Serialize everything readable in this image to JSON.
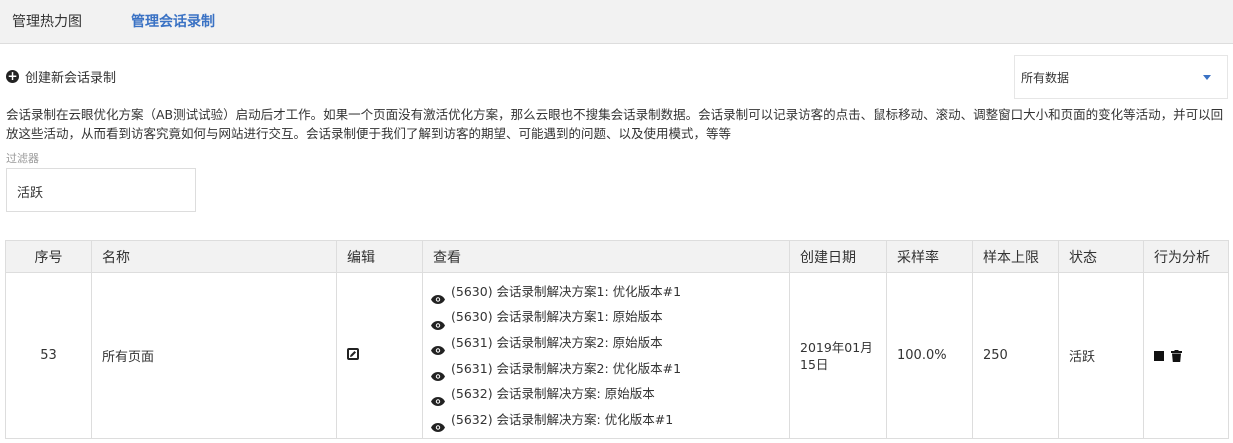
{
  "tabs": [
    {
      "label": "管理热力图",
      "active": false
    },
    {
      "label": "管理会话录制",
      "active": true
    }
  ],
  "create_button": {
    "label": "创建新会话录制",
    "icon": "plus-circle-icon"
  },
  "data_select": {
    "value": "所有数据"
  },
  "description": "会话录制在云眼优化方案（AB测试试验）启动后才工作。如果一个页面没有激活优化方案，那么云眼也不搜集会话录制数据。会话录制可以记录访客的点击、鼠标移动、滚动、调整窗口大小和页面的变化等活动，并可以回放这些活动，从而看到访客究竟如何与网站进行交互。会话录制便于我们了解到访客的期望、可能遇到的问题、以及使用模式，等等",
  "filter": {
    "label": "过滤器",
    "value": "活跃"
  },
  "table": {
    "headers": {
      "seq": "序号",
      "name": "名称",
      "edit": "编辑",
      "view": "查看",
      "created": "创建日期",
      "sample_rate": "采样率",
      "sample_limit": "样本上限",
      "status": "状态",
      "analysis": "行为分析"
    },
    "rows": [
      {
        "seq": "53",
        "name": "所有页面",
        "views": [
          "(5630) 会话录制解决方案1: 优化版本#1",
          "(5630) 会话录制解决方案1: 原始版本",
          "(5631) 会话录制解决方案2: 原始版本",
          "(5631) 会话录制解决方案2: 优化版本#1",
          "(5632) 会话录制解决方案: 原始版本",
          "(5632) 会话录制解决方案: 优化版本#1"
        ],
        "created": "2019年01月15日",
        "sample_rate": "100.0%",
        "sample_limit": "250",
        "status": "活跃"
      }
    ]
  },
  "colors": {
    "accent": "#3a72c4",
    "header_bg": "#f2f2f2",
    "border": "#dddddd"
  }
}
